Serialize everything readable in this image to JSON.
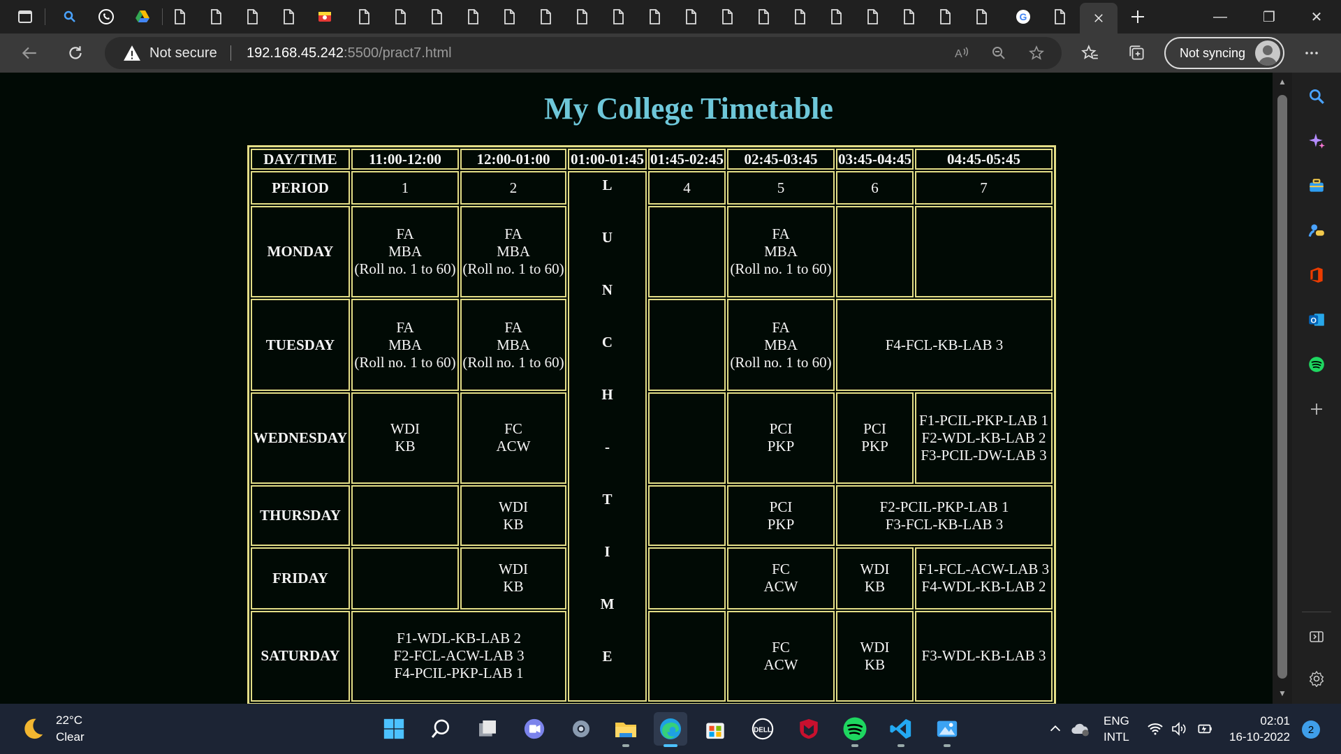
{
  "browser": {
    "tabs_count_label": "",
    "address": {
      "security_label": "Not secure",
      "host": "192.168.45.242",
      "path": ":5500/pract7.html"
    },
    "profile": {
      "sync_label": "Not syncing"
    }
  },
  "page": {
    "title": "My College Timetable",
    "timetable": {
      "corner_header": "DAY/TIME",
      "period_label": "PERIOD",
      "times": [
        "11:00-12:00",
        "12:00-01:00",
        "01:00-01:45",
        "01:45-02:45",
        "02:45-03:45",
        "03:45-04:45",
        "04:45-05:45"
      ],
      "periods": [
        "1",
        "2",
        "4",
        "5",
        "6",
        "7"
      ],
      "lunch_letters": [
        "L",
        "U",
        "N",
        "C",
        "H",
        "-",
        "T",
        "I",
        "M",
        "E"
      ],
      "days": {
        "monday": {
          "label": "MONDAY",
          "p1": [
            "FA",
            "MBA",
            "(Roll no. 1 to 60)"
          ],
          "p2": [
            "FA",
            "MBA",
            "(Roll no. 1 to 60)"
          ],
          "p5": [
            "FA",
            "MBA",
            "(Roll no. 1 to 60)"
          ]
        },
        "tuesday": {
          "label": "TUESDAY",
          "p1": [
            "FA",
            "MBA",
            "(Roll no. 1 to 60)"
          ],
          "p2": [
            "FA",
            "MBA",
            "(Roll no. 1 to 60)"
          ],
          "p5": [
            "FA",
            "MBA",
            "(Roll no. 1 to 60)"
          ],
          "p6_7": "F4-FCL-KB-LAB 3"
        },
        "wednesday": {
          "label": "WEDNESDAY",
          "p1": [
            "WDI",
            "KB"
          ],
          "p2": [
            "FC",
            "ACW"
          ],
          "p5": [
            "PCI",
            "PKP"
          ],
          "p6": [
            "PCI",
            "PKP"
          ],
          "p7": [
            "F1-PCIL-PKP-LAB 1",
            "F2-WDL-KB-LAB 2",
            "F3-PCIL-DW-LAB 3"
          ]
        },
        "thursday": {
          "label": "THURSDAY",
          "p2": [
            "WDI",
            "KB"
          ],
          "p5": [
            "PCI",
            "PKP"
          ],
          "p6_7": [
            "F2-PCIL-PKP-LAB 1",
            "F3-FCL-KB-LAB 3"
          ]
        },
        "friday": {
          "label": "FRIDAY",
          "p2": [
            "WDI",
            "KB"
          ],
          "p5": [
            "FC",
            "ACW"
          ],
          "p6": [
            "WDI",
            "KB"
          ],
          "p7": [
            "F1-FCL-ACW-LAB 3",
            "F4-WDL-KB-LAB 2"
          ]
        },
        "saturday": {
          "label": "SATURDAY",
          "p1_2": [
            "F1-WDL-KB-LAB 2",
            "F2-FCL-ACW-LAB 3",
            "F4-PCIL-PKP-LAB 1"
          ],
          "p5": [
            "FC",
            "ACW"
          ],
          "p6": [
            "WDI",
            "KB"
          ],
          "p7": "F3-WDL-KB-LAB 3"
        }
      }
    }
  },
  "taskbar": {
    "weather": {
      "temp": "22°C",
      "condition": "Clear"
    },
    "language": {
      "line1": "ENG",
      "line2": "INTL"
    },
    "clock": {
      "time": "02:01",
      "date": "16-10-2022"
    },
    "notifications": "2"
  },
  "colors": {
    "title": "#6ec7d9",
    "table_border": "#e3dd87",
    "page_bg": "#010a05",
    "taskbar_bg": "#1c2434"
  }
}
